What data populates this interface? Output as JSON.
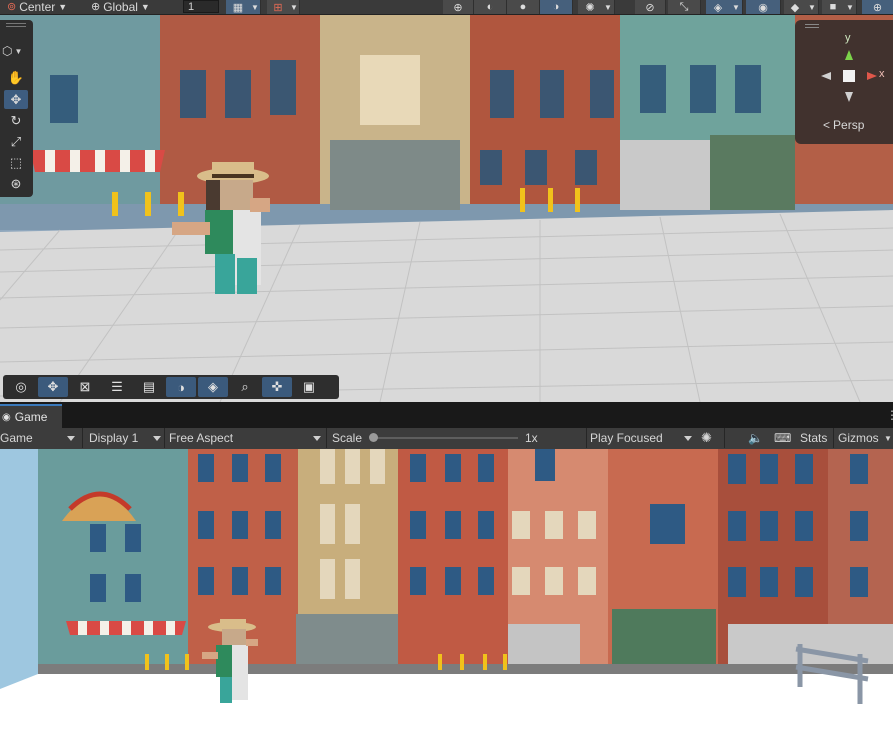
{
  "scene_toolbar": {
    "pivot_mode": "Center",
    "pivot_space": "Global",
    "grid_snap_value": "1",
    "icons": [
      "pivot-icon",
      "globe-icon",
      "grid-snap-icon",
      "snap-increment-icon",
      "wireframe-icon",
      "shaded-sphere-icon",
      "solid-sphere-icon",
      "lighting-icon",
      "effects-icon",
      "audio-mute-icon",
      "view-tool-icon",
      "layers-icon",
      "visibility-icon",
      "camera-icon",
      "gizmos-icon"
    ]
  },
  "tools": [
    "hand-icon",
    "move-icon",
    "rotate-icon",
    "scale-icon",
    "rect-icon",
    "transform-icon"
  ],
  "view_cube": {
    "persp_label": "Persp",
    "axis_y": "y",
    "axis_x": "x"
  },
  "overlay_tools": [
    "orbit-icon",
    "move-icon",
    "cinemachine-icon",
    "grid-icon",
    "navmesh-icon",
    "light-icon",
    "layers-icon",
    "search-icon",
    "pivot-icon",
    "camera-icon"
  ],
  "game": {
    "tab_label": "Game",
    "mode": "Game",
    "display": "Display 1",
    "aspect": "Free Aspect",
    "scale_label": "Scale",
    "scale_value": "1x",
    "play_mode": "Play Focused",
    "stats_label": "Stats",
    "gizmos_label": "Gizmos"
  },
  "colors": {
    "accent": "#3a79bb",
    "panel": "#3c3c3c",
    "toolbar_active": "#46607c"
  }
}
